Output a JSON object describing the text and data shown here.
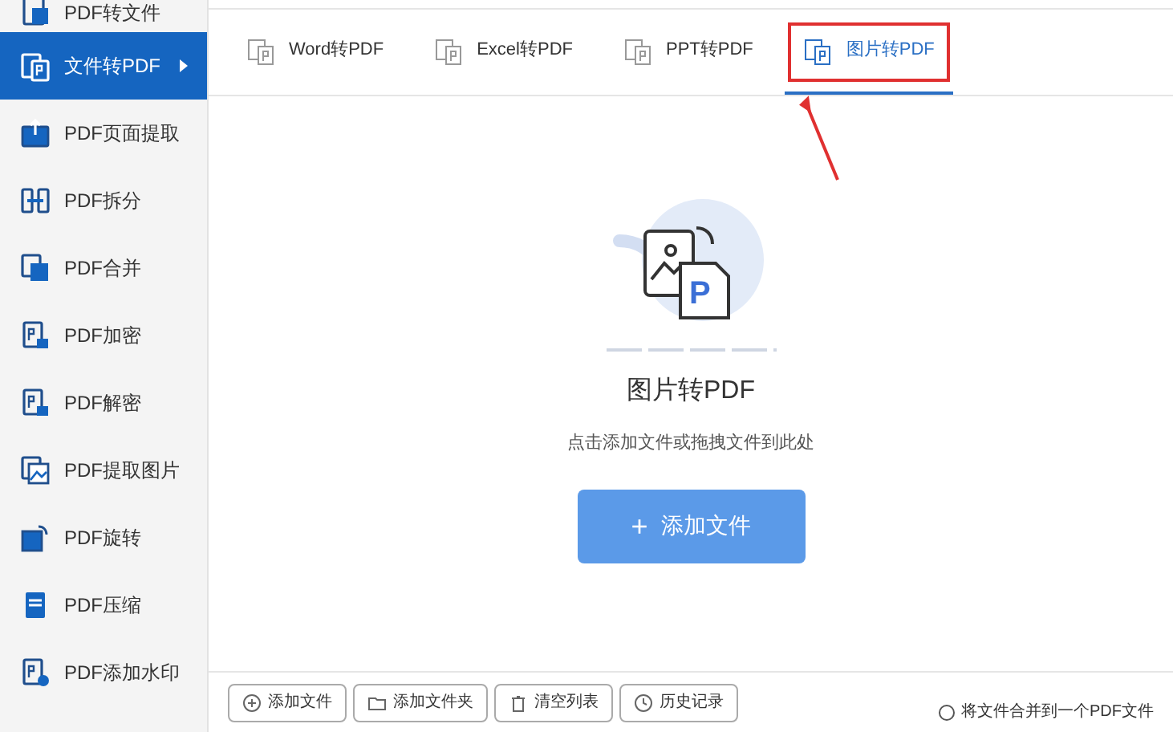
{
  "sidebar": {
    "items": [
      {
        "label": "PDF转文件",
        "selected": false
      },
      {
        "label": "文件转PDF",
        "selected": true
      },
      {
        "label": "PDF页面提取",
        "selected": false
      },
      {
        "label": "PDF拆分",
        "selected": false
      },
      {
        "label": "PDF合并",
        "selected": false
      },
      {
        "label": "PDF加密",
        "selected": false
      },
      {
        "label": "PDF解密",
        "selected": false
      },
      {
        "label": "PDF提取图片",
        "selected": false
      },
      {
        "label": "PDF旋转",
        "selected": false
      },
      {
        "label": "PDF压缩",
        "selected": false
      },
      {
        "label": "PDF添加水印",
        "selected": false
      }
    ]
  },
  "tabs": [
    {
      "label": "Word转PDF",
      "selected": false
    },
    {
      "label": "Excel转PDF",
      "selected": false
    },
    {
      "label": "PPT转PDF",
      "selected": false
    },
    {
      "label": "图片转PDF",
      "selected": true,
      "highlighted": true
    }
  ],
  "drop_zone": {
    "illustration_letter": "P",
    "title": "图片转PDF",
    "hint": "点击添加文件或拖拽文件到此处",
    "button_icon": "+",
    "button": "添加文件"
  },
  "toolbar": [
    "添加文件",
    "添加文件夹",
    "清空列表",
    "历史记录"
  ],
  "merge_option": {
    "label": "将文件合并到一个PDF文件",
    "checked": false
  }
}
